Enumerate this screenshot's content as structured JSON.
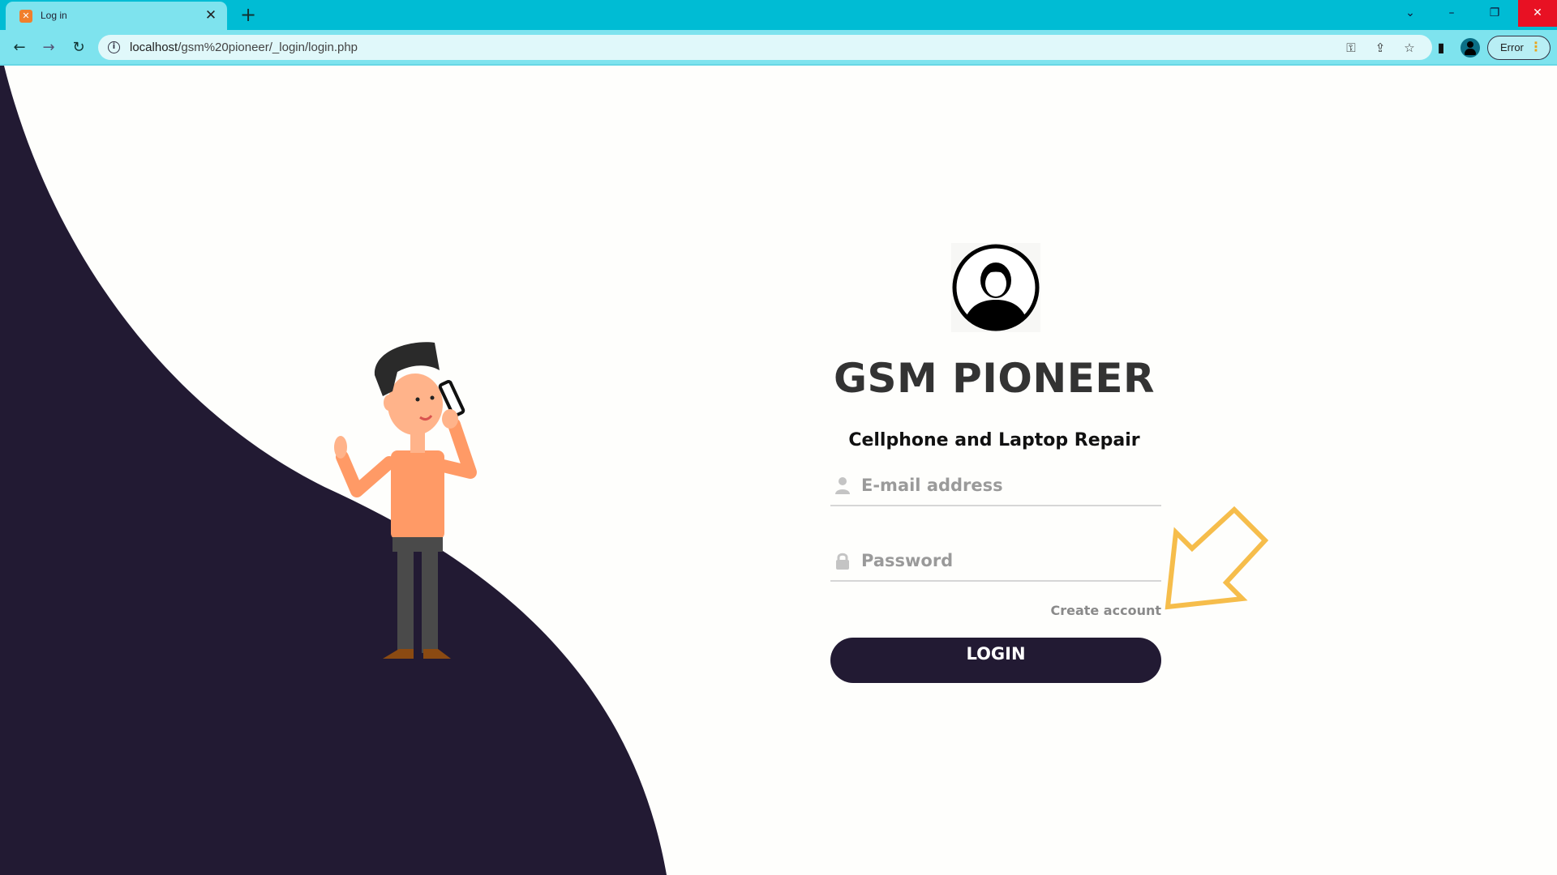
{
  "browser": {
    "tab_title": "Log in",
    "tab_favicon": "xampp-icon",
    "url_host": "localhost",
    "url_path": "/gsm%20pioneer/_login/login.php",
    "profile_status": "Error"
  },
  "login": {
    "brand_title": "GSM PIONEER",
    "tagline": "Cellphone and Laptop Repair",
    "email_placeholder": "E-mail address",
    "password_placeholder": "Password",
    "create_account_label": "Create account",
    "login_button_label": "LOGIN"
  },
  "colors": {
    "tab_strip": "#00bcd4",
    "toolbar": "#7ee3ee",
    "page_background": "#fefefc",
    "wave_dark": "#221a33",
    "login_button": "#221a33",
    "arrow_accent": "#f6bd4b",
    "close_button": "#e81123"
  },
  "icons": [
    "user-icon",
    "lock-icon",
    "key-icon",
    "share-icon",
    "star-icon",
    "side-panel-icon",
    "profile-icon",
    "more-menu-icon",
    "arrow-pointer-icon"
  ]
}
